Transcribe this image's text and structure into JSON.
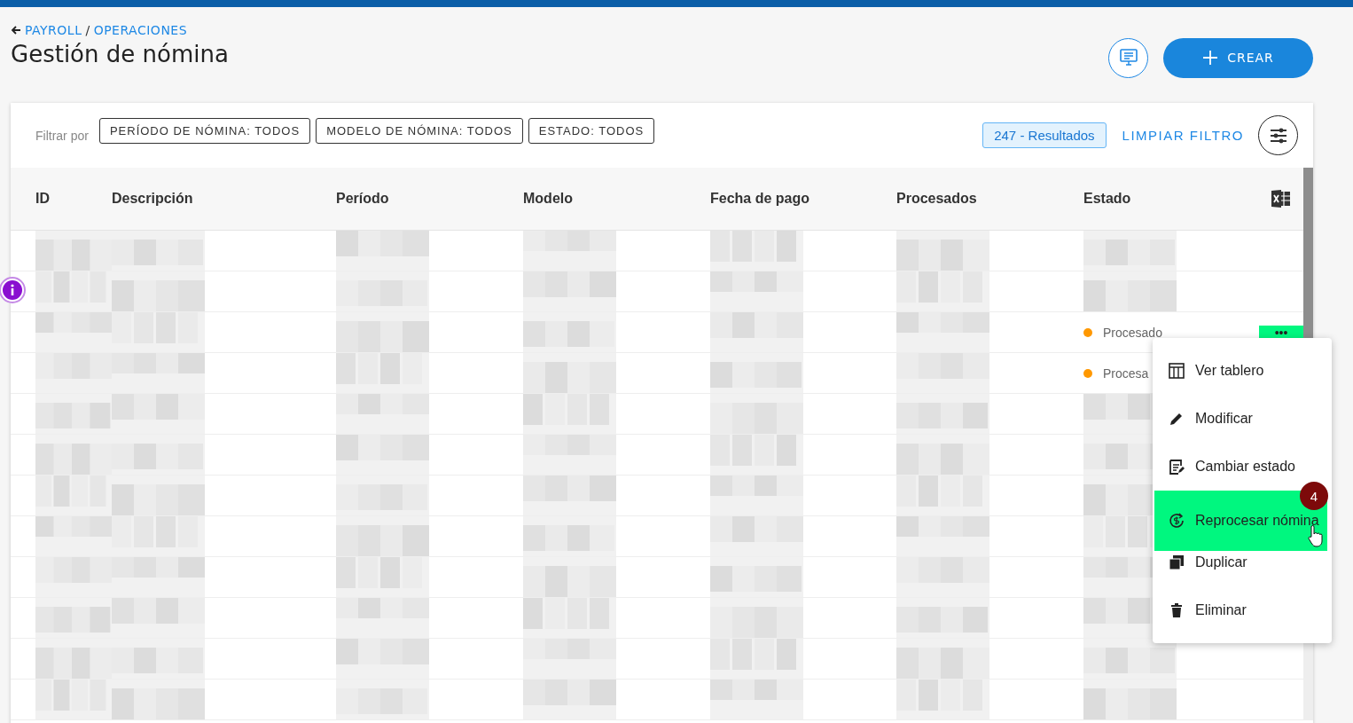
{
  "breadcrumb": {
    "items": [
      "PAYROLL",
      "OPERACIONES"
    ],
    "separator": "/"
  },
  "title": "Gestión de nómina",
  "create_button": "CREAR",
  "filters": {
    "label": "Filtrar por",
    "chips": [
      "PERÍODO DE NÓMINA: TODOS",
      "MODELO DE NÓMINA: TODOS",
      "ESTADO: TODOS"
    ],
    "results": "247 - Resultados",
    "clear": "LIMPIAR FILTRO"
  },
  "table": {
    "columns": [
      "ID",
      "Descripción",
      "Período",
      "Modelo",
      "Fecha de pago",
      "Procesados",
      "Estado"
    ],
    "rows": [
      {
        "kind": "redacted"
      },
      {
        "kind": "redacted"
      },
      {
        "kind": "status",
        "status": "Procesado",
        "color": "#ff9800",
        "actions": "•••",
        "selected": true
      },
      {
        "kind": "status",
        "status": "Procesa",
        "color": "#ff9800"
      },
      {
        "kind": "redacted"
      },
      {
        "kind": "redacted"
      },
      {
        "kind": "redacted"
      },
      {
        "kind": "redacted"
      },
      {
        "kind": "redacted"
      },
      {
        "kind": "redacted"
      },
      {
        "kind": "redacted"
      },
      {
        "kind": "redacted"
      }
    ]
  },
  "menu": {
    "items": [
      {
        "kind": "board",
        "label": "Ver tablero",
        "selected": false
      },
      {
        "kind": "edit",
        "label": "Modificar",
        "selected": false
      },
      {
        "kind": "status",
        "label": "Cambiar estado",
        "selected": false
      },
      {
        "kind": "reprocess",
        "label": "Reprocesar nómina",
        "selected": true,
        "badge": "4"
      },
      {
        "kind": "duplicate",
        "label": "Duplicar",
        "selected": false
      },
      {
        "kind": "delete",
        "label": "Eliminar",
        "selected": false
      }
    ]
  }
}
